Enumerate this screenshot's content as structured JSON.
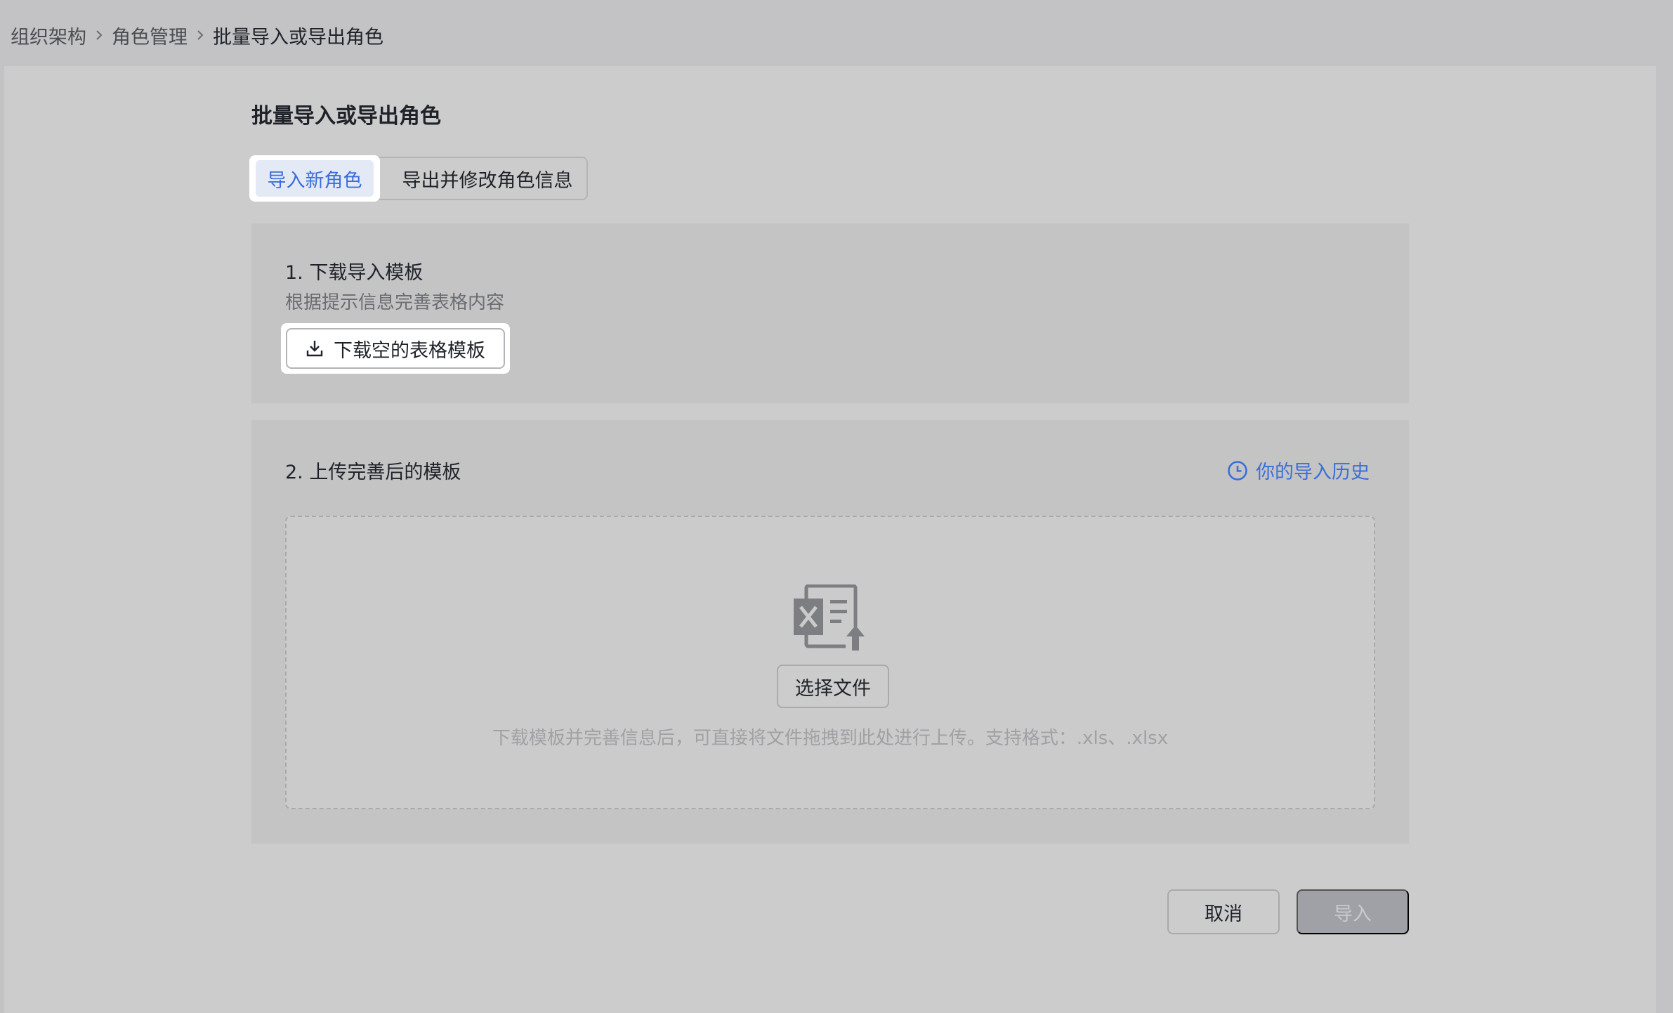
{
  "breadcrumb": {
    "items": [
      "组织架构",
      "角色管理",
      "批量导入或导出角色"
    ]
  },
  "page": {
    "title": "批量导入或导出角色"
  },
  "tabs": {
    "active": "导入新角色",
    "inactive": "导出并修改角色信息"
  },
  "step1": {
    "title": "1. 下载导入模板",
    "description": "根据提示信息完善表格内容",
    "download_label": "下载空的表格模板",
    "download_icon": "download-icon"
  },
  "step2": {
    "title": "2. 上传完善后的模板",
    "history_label": "你的导入历史",
    "history_icon": "clock-icon",
    "upload_icon": "excel-upload-icon",
    "choose_file_label": "选择文件",
    "hint": "下载模板并完善信息后，可直接将文件拖拽到此处进行上传。支持格式：.xls、.xlsx"
  },
  "footer": {
    "cancel_label": "取消",
    "import_label": "导入"
  },
  "colors": {
    "accent": "#3a6fd8",
    "background": "#c3c3c5",
    "panel": "#cccccc"
  }
}
